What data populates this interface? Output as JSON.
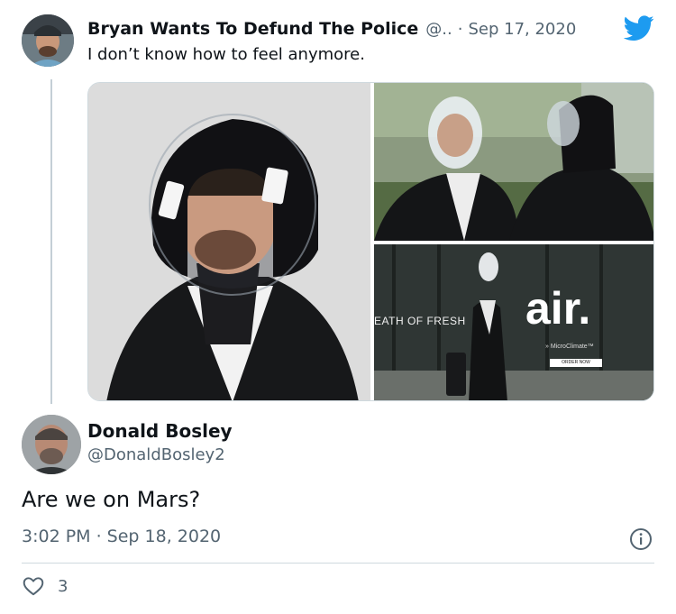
{
  "tweet": {
    "author_name": "Bryan Wants To Defund The Police",
    "handle": "@..",
    "separator": "·",
    "date": "Sep 17, 2020",
    "text": "I don’t know how to feel anymore."
  },
  "media": {
    "poster_text_left": "EATH OF FRESH",
    "poster_brand": "air.",
    "poster_tagline": "» MicroClimate™",
    "poster_button": "ORDER NOW"
  },
  "reply": {
    "author_name": "Donald Bosley",
    "handle": "@DonaldBosley2",
    "text": "Are we on Mars?",
    "meta": "3:02 PM · Sep 18, 2020",
    "like_count": "3"
  },
  "colors": {
    "twitter_blue": "#1d9bf0",
    "text_primary": "#0f1419",
    "text_secondary": "#536471",
    "divider": "#cfd9de"
  },
  "icons": {
    "brand": "twitter-bird-icon",
    "info": "info-icon",
    "like": "heart-icon"
  }
}
